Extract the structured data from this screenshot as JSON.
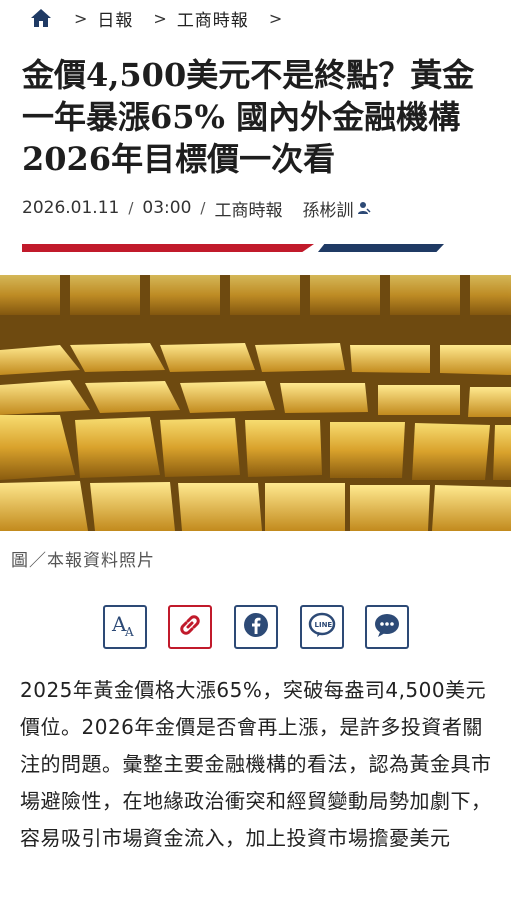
{
  "breadcrumb": {
    "home_icon": "home-icon",
    "items": [
      "日報",
      "工商時報"
    ]
  },
  "article": {
    "title": "金價4,500美元不是終點？黃金一年暴漲65% 國內外金融機構2026年目標價一次看",
    "date": "2026.01.11",
    "time": "03:00",
    "source": "工商時報",
    "author": "孫彬訓",
    "image_caption": "圖／本報資料照片",
    "paragraph": "2025年黃金價格大漲65%，突破每盎司4,500美元價位。2026年金價是否會再上漲，是許多投資者關注的問題。彙整主要金融機構的看法，認為黃金具市場避險性，在地緣政治衝突和經貿變動局勢加劇下，容易吸引市場資金流入，加上投資市場擔憂美元"
  },
  "share_buttons": [
    {
      "icon": "font-size-icon"
    },
    {
      "icon": "link-icon"
    },
    {
      "icon": "facebook-icon"
    },
    {
      "icon": "line-icon"
    },
    {
      "icon": "comment-icon"
    }
  ],
  "colors": {
    "accent_red": "#c11a2b",
    "accent_blue": "#1f3a64",
    "icon_blue": "#2d4a76"
  }
}
